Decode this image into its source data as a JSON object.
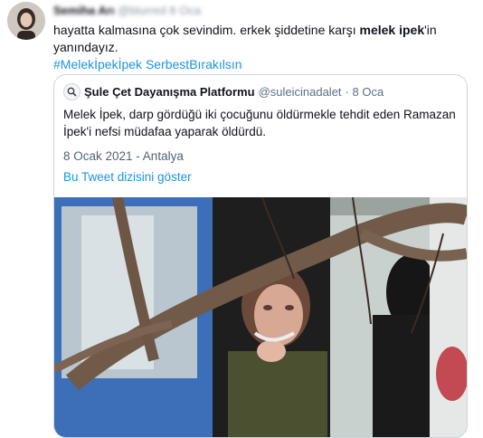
{
  "tweet": {
    "author_name": "Semiha Arı",
    "author_handle": "@blurred",
    "time": "8 Oca",
    "text_prefix": "hayatta kalmasına çok sevindim. erkek şiddetine karşı ",
    "text_bold": "melek ipek",
    "text_suffix": "'in yanındayız.",
    "hashtag": "#Melekİpekİpek SerbestBırakılsın"
  },
  "quote": {
    "name": "Şule Çet Dayanışma Platformu",
    "handle": "@suleicinadalet",
    "time": "· 8 Oca",
    "body": "Melek İpek, darp gördüğü iki çocuğunu öldürmekle tehdit eden Ramazan İpek'i nefsi müdafaa yaparak öldürdü.",
    "date_location": "8 Ocak 2021 - Antalya",
    "thread_link": "Bu Tweet dizisini göster"
  },
  "icons": {
    "quote_avatar": "magnifier-icon"
  }
}
